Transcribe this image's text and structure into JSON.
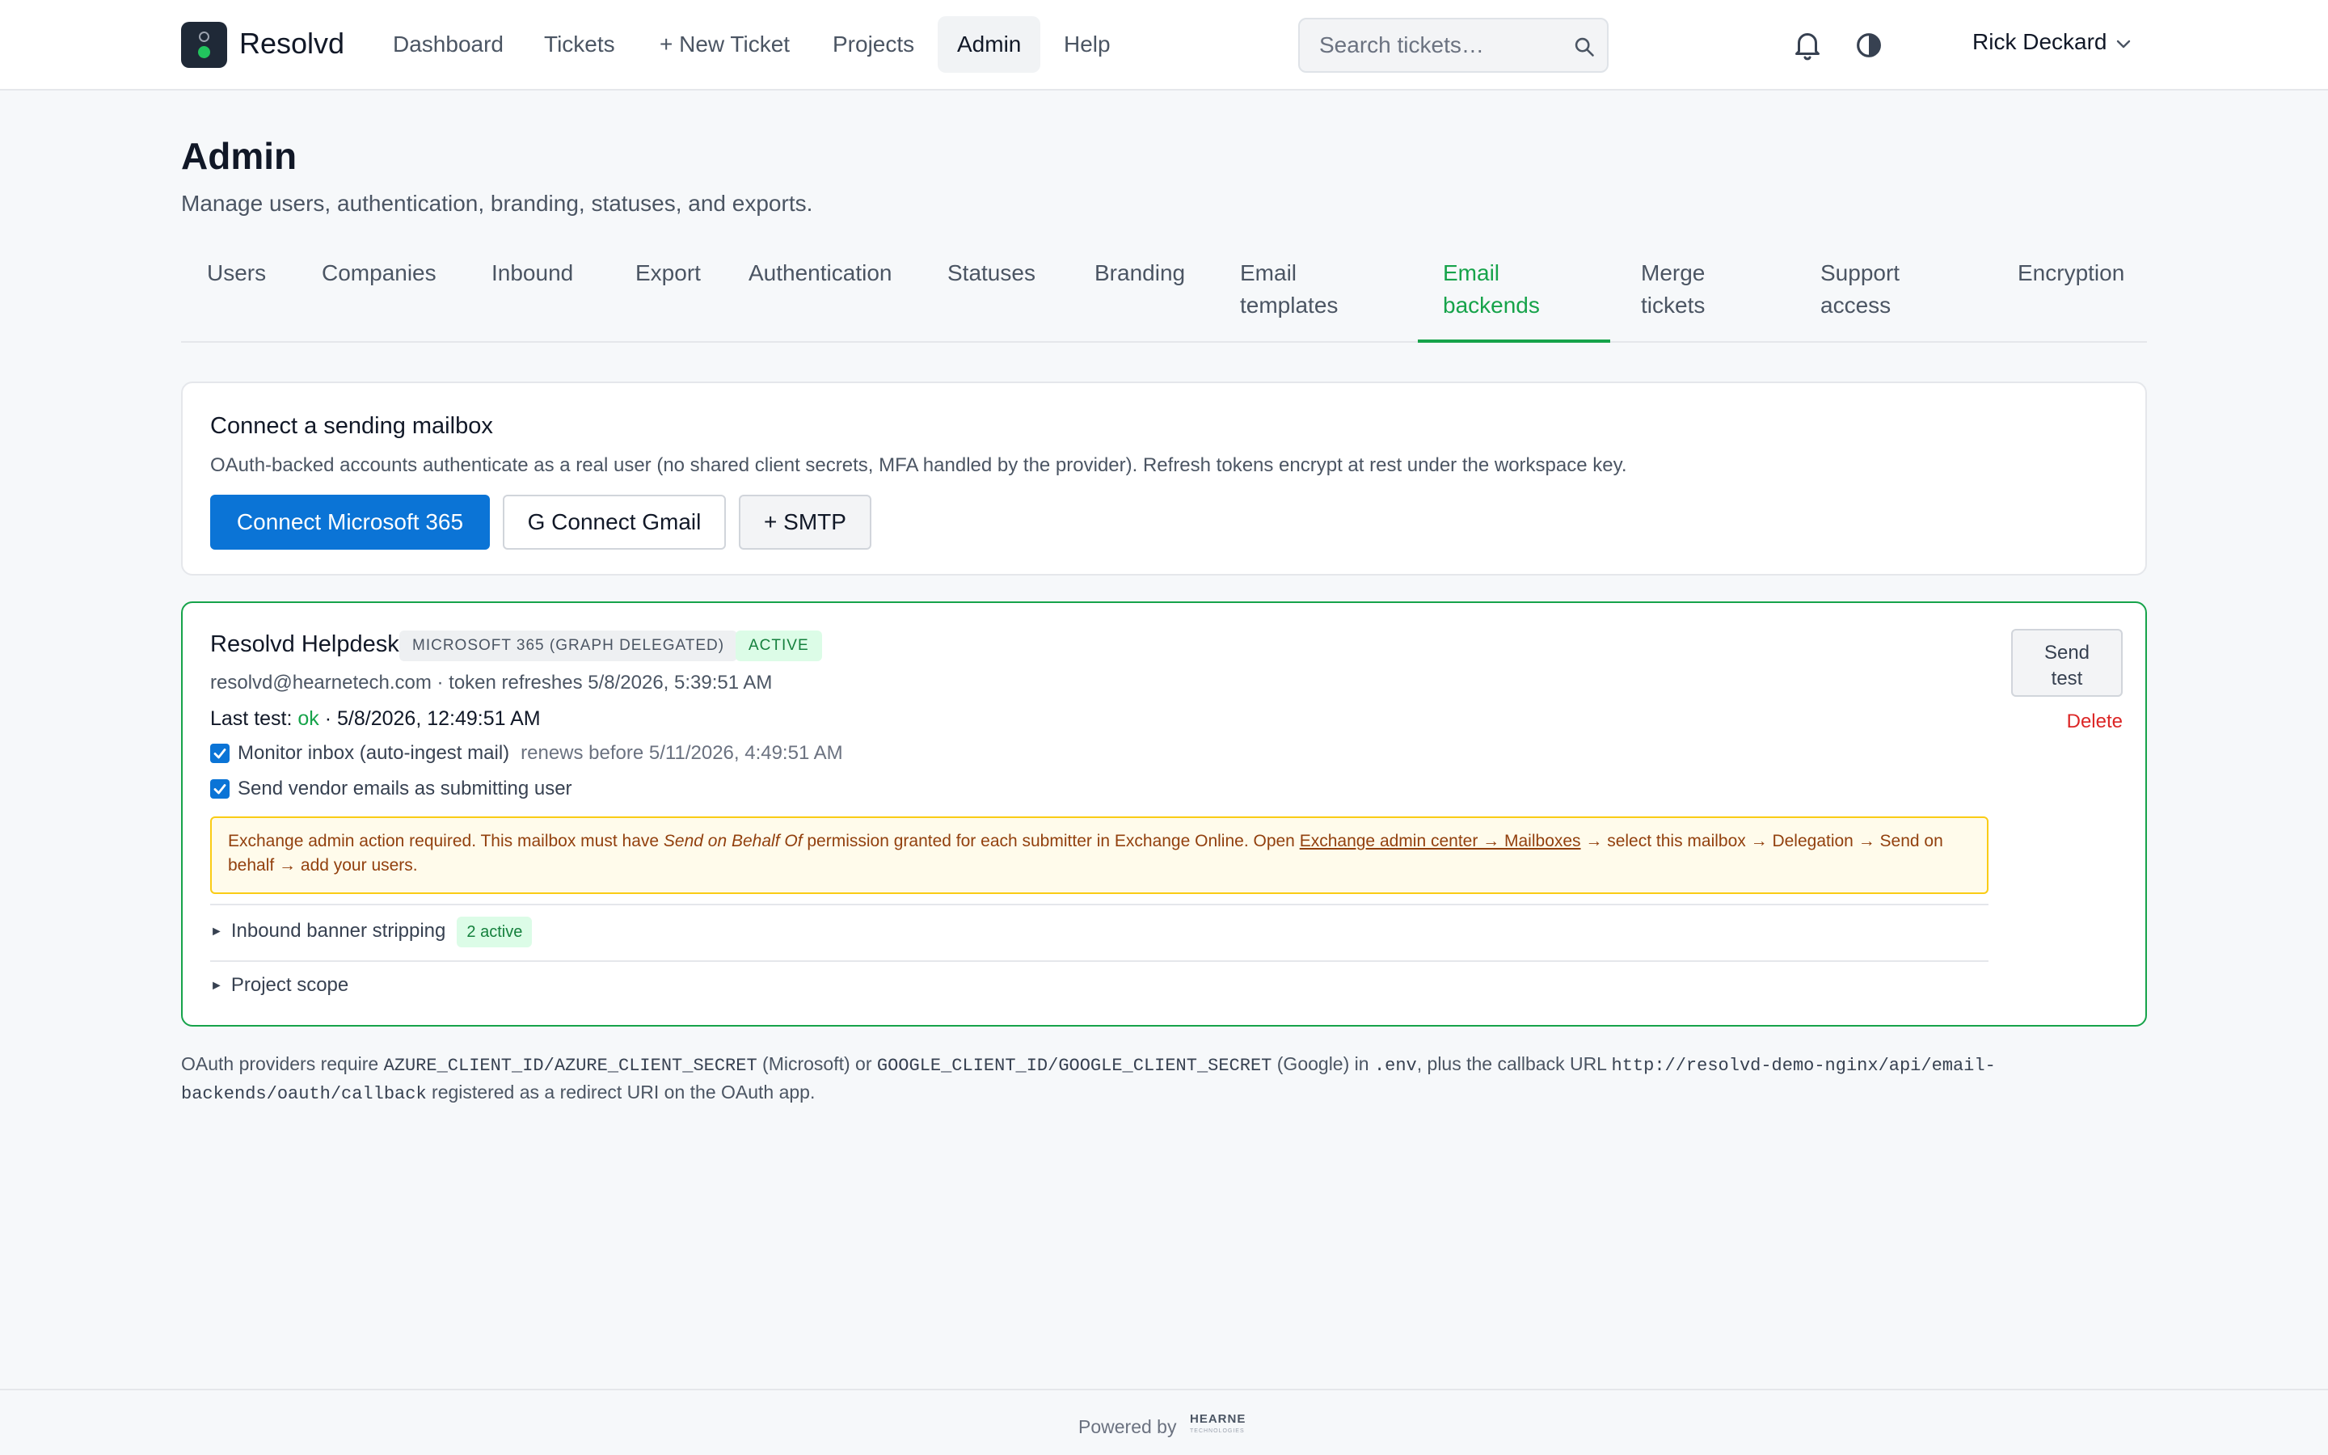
{
  "app": {
    "brand": "Resolvd"
  },
  "nav": {
    "items": [
      {
        "label": "Dashboard",
        "active": false
      },
      {
        "label": "Tickets",
        "active": false
      },
      {
        "label": "+ New Ticket",
        "active": false
      },
      {
        "label": "Projects",
        "active": false
      },
      {
        "label": "Admin",
        "active": true
      },
      {
        "label": "Help",
        "active": false
      }
    ],
    "search_placeholder": "Search tickets…",
    "user_name": "Rick Deckard"
  },
  "header": {
    "title": "Admin",
    "subtitle": "Manage users, authentication, branding, statuses, and exports."
  },
  "tabs": [
    {
      "label": "Users",
      "active": false
    },
    {
      "label": "Companies",
      "active": false
    },
    {
      "label": "Inbound",
      "active": false
    },
    {
      "label": "Export",
      "active": false
    },
    {
      "label": "Authentication",
      "active": false
    },
    {
      "label": "Statuses",
      "active": false
    },
    {
      "label": "Branding",
      "active": false
    },
    {
      "label": "Email\ntemplates",
      "active": false
    },
    {
      "label": "Email\nbackends",
      "active": true
    },
    {
      "label": "Merge\ntickets",
      "active": false
    },
    {
      "label": "Support\naccess",
      "active": false
    },
    {
      "label": "Encryption",
      "active": false
    }
  ],
  "connect": {
    "title": "Connect a sending mailbox",
    "description": "OAuth-backed accounts authenticate as a real user (no shared client secrets, MFA handled by the provider). Refresh tokens encrypt at rest under the workspace key.",
    "btn_microsoft": "Connect Microsoft 365",
    "btn_gmail": "G  Connect Gmail",
    "btn_smtp": "+ SMTP"
  },
  "backend": {
    "name": "Resolvd Helpdesk",
    "provider_badge": "MICROSOFT 365 (GRAPH DELEGATED)",
    "status_badge": "ACTIVE",
    "meta": "resolvd@hearnetech.com · token refreshes 5/8/2026, 5:39:51 AM",
    "last_test_label": "Last test: ",
    "last_test_status": "ok",
    "last_test_time": " · 5/8/2026, 12:49:51 AM",
    "monitor_label": "Monitor inbox (auto-ingest mail)",
    "monitor_note": "renews before 5/11/2026, 4:49:51 AM",
    "monitor_checked": true,
    "send_as_label": "Send vendor emails as submitting user",
    "send_as_checked": true,
    "warning": {
      "part1": "Exchange admin action required. This mailbox must have ",
      "emphasis": "Send on Behalf Of",
      "part2": " permission granted for each submitter in Exchange Online. Open ",
      "link": "Exchange admin center → Mailboxes",
      "part3": " → select this mailbox → Delegation → Send on behalf → add your users."
    },
    "banner_stripping_label": "Inbound banner stripping",
    "banner_stripping_count": "2 active",
    "project_scope_label": "Project scope",
    "send_test_label": "Send\ntest",
    "delete_label": "Delete"
  },
  "footnote": {
    "t1": "OAuth providers require ",
    "c1": "AZURE_CLIENT_ID/AZURE_CLIENT_SECRET",
    "t2": " (Microsoft) or ",
    "c2": "GOOGLE_CLIENT_ID/GOOGLE_CLIENT_SECRET",
    "t3": " (Google) in ",
    "c3": ".env",
    "t4": ", plus the callback URL ",
    "c4": "http://resolvd-demo-nginx/api/email-backends/oauth/callback",
    "t5": " registered as a redirect URI on the OAuth app."
  },
  "footer": {
    "powered_by": "Powered by",
    "logo_text": "HEARNE",
    "logo_sub": "TECHNOLOGIES"
  },
  "colors": {
    "accent_green": "#16a34a",
    "primary_blue": "#0b74d6",
    "danger_red": "#dc2626",
    "warning_bg": "#fffbeb",
    "warning_border": "#facc15"
  },
  "icons": {
    "logo": "traffic-light-logo-icon",
    "search": "search-icon",
    "notifications": "bell-icon",
    "theme": "contrast-icon",
    "user_menu": "chevron-down-icon",
    "checkbox": "check-icon",
    "disclosure": "triangle-right-icon"
  }
}
